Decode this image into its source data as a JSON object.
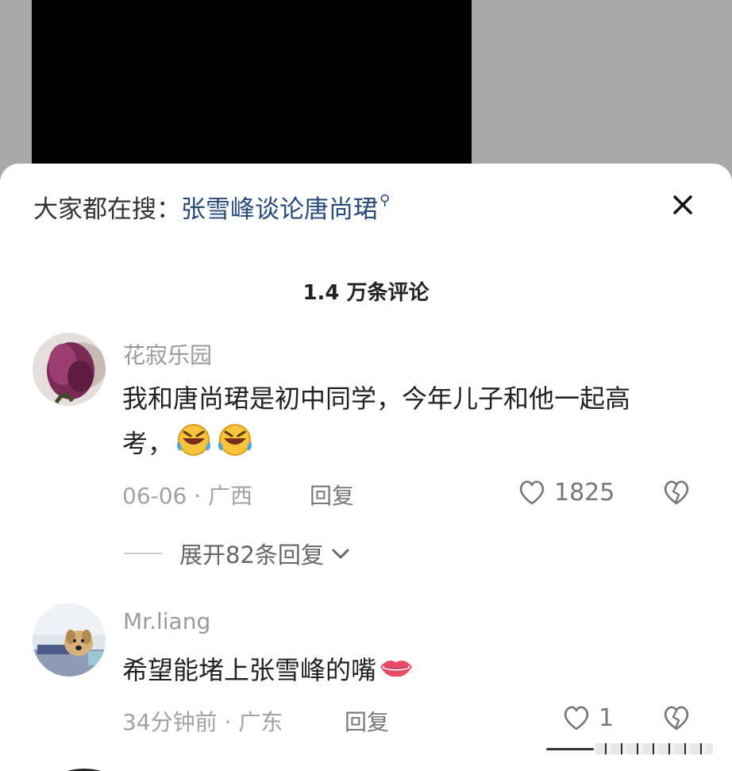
{
  "search": {
    "prefix": "大家都在搜：",
    "term": "张雪峰谈论唐尚珺"
  },
  "header": {
    "comment_count": "1.4 万条评论"
  },
  "comments": [
    {
      "username": "花寂乐园",
      "text": "我和唐尚珺是初中同学，今年儿子和他一起高考，",
      "emoji": [
        "rofl-face-icon",
        "rofl-face-icon"
      ],
      "meta": "06-06 · 广西",
      "reply_label": "回复",
      "likes": "1825",
      "expand_label": "展开82条回复"
    },
    {
      "username": "Mr.liang",
      "text": "希望能堵上张雪峰的嘴",
      "emoji": [
        "lips-icon"
      ],
      "meta": "34分钟前 · 广东",
      "reply_label": "回复",
      "likes": "1"
    }
  ],
  "colors": {
    "search_term": "#2a4a78",
    "backdrop": "#a9a9a9",
    "video": "#000000"
  }
}
